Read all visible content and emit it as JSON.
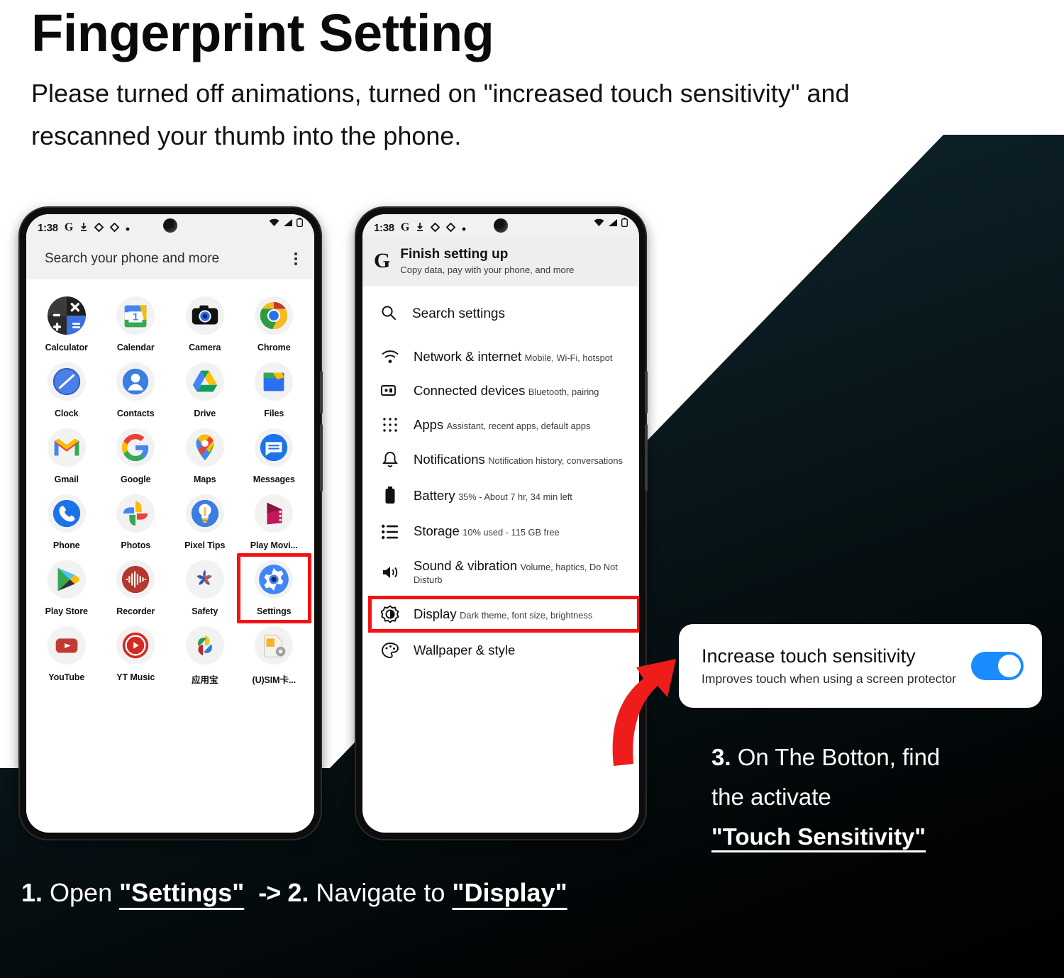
{
  "header": {
    "title": "Fingerprint Setting",
    "subtitle": "Please turned off animations, turned on \"increased touch sensitivity\" and rescanned your thumb into the phone."
  },
  "phone1": {
    "statusbar": {
      "time": "1:38",
      "left_icons": [
        "google-g-icon",
        "download-icon",
        "diamond-icon",
        "diamond-icon",
        "dot-icon"
      ],
      "right_icons": [
        "wifi-icon",
        "signal-icon",
        "battery-icon"
      ]
    },
    "searchbar": {
      "placeholder": "Search your phone and more",
      "menu": "more-options-icon"
    },
    "apps": [
      {
        "label": "Calculator",
        "icon": "calculator-icon"
      },
      {
        "label": "Calendar",
        "icon": "calendar-icon"
      },
      {
        "label": "Camera",
        "icon": "camera-icon"
      },
      {
        "label": "Chrome",
        "icon": "chrome-icon"
      },
      {
        "label": "Clock",
        "icon": "clock-icon"
      },
      {
        "label": "Contacts",
        "icon": "contacts-icon"
      },
      {
        "label": "Drive",
        "icon": "drive-icon"
      },
      {
        "label": "Files",
        "icon": "files-icon"
      },
      {
        "label": "Gmail",
        "icon": "gmail-icon"
      },
      {
        "label": "Google",
        "icon": "google-icon"
      },
      {
        "label": "Maps",
        "icon": "maps-icon"
      },
      {
        "label": "Messages",
        "icon": "messages-icon"
      },
      {
        "label": "Phone",
        "icon": "phone-icon"
      },
      {
        "label": "Photos",
        "icon": "photos-icon"
      },
      {
        "label": "Pixel Tips",
        "icon": "pixel-tips-icon"
      },
      {
        "label": "Play Movi...",
        "icon": "play-movies-icon"
      },
      {
        "label": "Play Store",
        "icon": "play-store-icon"
      },
      {
        "label": "Recorder",
        "icon": "recorder-icon"
      },
      {
        "label": "Safety",
        "icon": "safety-icon"
      },
      {
        "label": "Settings",
        "icon": "settings-gear-icon",
        "highlighted": true
      },
      {
        "label": "YouTube",
        "icon": "youtube-icon"
      },
      {
        "label": "YT Music",
        "icon": "yt-music-icon"
      },
      {
        "label": "应用宝",
        "icon": "yingyongbao-icon"
      },
      {
        "label": "(U)SIM卡...",
        "icon": "usim-icon"
      }
    ]
  },
  "phone2": {
    "statusbar": {
      "time": "1:38",
      "left_icons": [
        "google-g-icon",
        "download-icon",
        "diamond-icon",
        "diamond-icon",
        "dot-icon"
      ],
      "right_icons": [
        "wifi-icon",
        "signal-icon",
        "battery-icon"
      ]
    },
    "finish_setup": {
      "logo": "G",
      "title": "Finish setting up",
      "subtitle": "Copy data, pay with your phone, and more"
    },
    "search": {
      "label": "Search settings",
      "icon": "search-icon"
    },
    "settings_rows": [
      {
        "title": "Network & internet",
        "subtitle": "Mobile, Wi-Fi, hotspot",
        "icon": "wifi-icon"
      },
      {
        "title": "Connected devices",
        "subtitle": "Bluetooth, pairing",
        "icon": "connected-devices-icon"
      },
      {
        "title": "Apps",
        "subtitle": "Assistant, recent apps, default apps",
        "icon": "apps-grid-icon"
      },
      {
        "title": "Notifications",
        "subtitle": "Notification history, conversations",
        "icon": "bell-icon"
      },
      {
        "title": "Battery",
        "subtitle": "35% - About 7 hr, 34 min left",
        "icon": "battery-icon"
      },
      {
        "title": "Storage",
        "subtitle": "10% used - 115 GB free",
        "icon": "storage-icon"
      },
      {
        "title": "Sound & vibration",
        "subtitle": "Volume, haptics, Do Not Disturb",
        "icon": "volume-icon"
      },
      {
        "title": "Display",
        "subtitle": "Dark theme, font size, brightness",
        "icon": "brightness-icon",
        "highlighted": true
      },
      {
        "title": "Wallpaper & style",
        "subtitle": "",
        "icon": "wallpaper-icon"
      }
    ]
  },
  "touch_card": {
    "title": "Increase touch sensitivity",
    "subtitle": "Improves touch when using a screen protector",
    "toggle_state": "on",
    "toggle_color": "#1a8cff"
  },
  "step3": {
    "number": "3.",
    "line1": " On The Botton, find",
    "line2": "the activate",
    "emphasis": "\"Touch Sensitivity\""
  },
  "caption": {
    "step1_num": "1.",
    "step1_text": " Open ",
    "step1_emphasis": "\"Settings\"",
    "arrow": "->",
    "step2_num": "2.",
    "step2_text": " Navigate to ",
    "step2_emphasis": "\"Display\""
  },
  "colors": {
    "accent_red": "#f21313",
    "toggle_blue": "#1a8cff",
    "dark_bg": "#0f2730"
  }
}
